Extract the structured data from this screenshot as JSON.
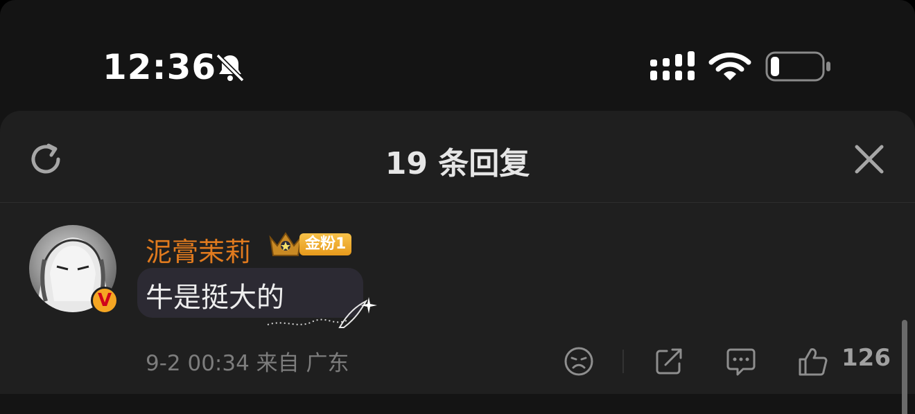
{
  "status_bar": {
    "time": "12:36"
  },
  "sheet": {
    "title": "19 条回复"
  },
  "comment": {
    "username": "泥膏茉莉",
    "fan_badge": "金粉1",
    "verified_badge": "V",
    "text": "牛是挺大的",
    "meta": "9-2 00:34 来自 广东",
    "likes": "126"
  },
  "colors": {
    "background": "#1f1f1f",
    "username": "#e07a1e",
    "badge": "#f5a623"
  },
  "icons": [
    "bell-slash-icon",
    "signal-icon",
    "wifi-icon",
    "battery-icon",
    "refresh-icon",
    "close-icon",
    "crown-icon",
    "dislike-icon",
    "share-icon",
    "reply-icon",
    "like-icon"
  ]
}
